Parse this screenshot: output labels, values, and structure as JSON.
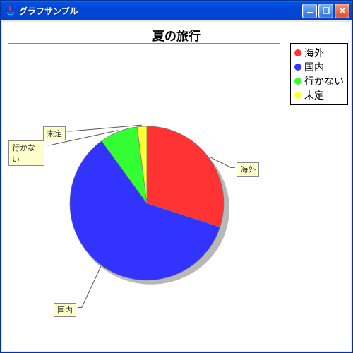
{
  "window": {
    "title": "グラフサンプル"
  },
  "chart_data": {
    "type": "pie",
    "title": "夏の旅行",
    "series": [
      {
        "name": "海外",
        "value": 30,
        "color": "#ff3333"
      },
      {
        "name": "国内",
        "value": 60,
        "color": "#3333ff"
      },
      {
        "name": "行かない",
        "value": 8,
        "color": "#33ff33"
      },
      {
        "name": "未定",
        "value": 2,
        "color": "#ffff33"
      }
    ],
    "legend": {
      "position": "right"
    }
  },
  "legend_labels": {
    "l0": "海外",
    "l1": "国内",
    "l2": "行かない",
    "l3": "未定"
  },
  "callouts": {
    "c0": "海外",
    "c1": "国内",
    "c2": "行かない",
    "c3": "未定"
  }
}
